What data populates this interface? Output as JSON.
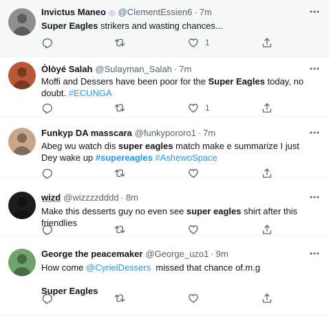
{
  "tweets": [
    {
      "name": "Invictus Maneo",
      "badge": "◎",
      "handle": "@ClementEssien6",
      "dot": "·",
      "time": "7m",
      "text": [
        {
          "t": "Super Eagles",
          "bold": true
        },
        {
          "t": " strikers and wasting chances..."
        }
      ],
      "likes": "1",
      "avatar_color": "#8f8f8f"
    },
    {
      "name": "Òlòyé Salah",
      "handle": "@Sulayman_Salah",
      "dot": "·",
      "time": "7m",
      "text": [
        {
          "t": "Moffi and Dessers have been poor for the "
        },
        {
          "t": "Super Eagles",
          "bold": true
        },
        {
          "t": " today, no doubt. "
        },
        {
          "t": "#ECUNGA",
          "link": true
        }
      ],
      "likes": "1",
      "avatar_color": "#b85a3a"
    },
    {
      "name": "Funkyp DA masscara",
      "handle": "@funkypororo1",
      "dot": "·",
      "time": "7m",
      "text": [
        {
          "t": "Abeg wu watch dis "
        },
        {
          "t": "super eagles",
          "bold": true
        },
        {
          "t": " match make e summarize I just Dey wake up "
        },
        {
          "t": "#supereagles",
          "link": true,
          "bold": true
        },
        {
          "t": " "
        },
        {
          "t": "#AshewoSpace",
          "link": true
        }
      ],
      "likes": "",
      "avatar_color": "#c9a58a"
    },
    {
      "name": "w̲i̲z̲d̲",
      "handle": "@wizzzzdddd",
      "dot": "·",
      "time": "8m",
      "text": [
        {
          "t": "Make this desserts guy no even see "
        },
        {
          "t": "super eagles",
          "bold": true
        },
        {
          "t": " shirt after this friendlies"
        }
      ],
      "likes": "",
      "avatar_color": "#1c1c1c"
    },
    {
      "name": "George the peacemaker",
      "handle": "@George_uzo1",
      "dot": "·",
      "time": "9m",
      "text": [
        {
          "t": "How come "
        },
        {
          "t": "@CyrielDessers",
          "link": true
        },
        {
          "t": "  missed that chance of.m.g"
        }
      ],
      "text2": "Super Eagles",
      "likes": "",
      "avatar_color": "#6fa36b"
    }
  ],
  "colors": {
    "accent": "#1d9bf0",
    "muted": "#536471",
    "text": "#0f1419"
  }
}
